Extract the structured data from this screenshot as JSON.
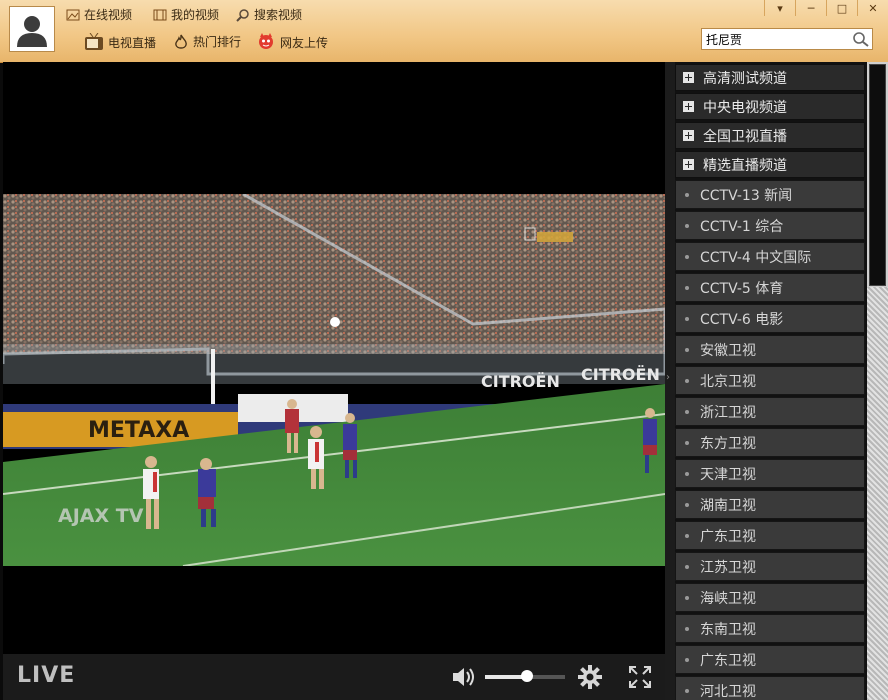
{
  "toolbar": {
    "online_video": "在线视频",
    "my_video": "我的视频",
    "search_video": "搜索视频",
    "tv_live": "电视直播",
    "hot_rank": "热门排行",
    "user_upload": "网友上传",
    "search_value": "托尼贾"
  },
  "player": {
    "live_label": "LIVE",
    "volume_level": 0.52,
    "watermark_channel": "AJAX TV",
    "ad_boards": [
      "METAXA",
      "CITROËN",
      "CITROËN"
    ]
  },
  "categories": [
    "高清测试频道",
    "中央电视频道",
    "全国卫视直播",
    "精选直播频道"
  ],
  "channels": [
    "CCTV-13 新闻",
    "CCTV-1 综合",
    "CCTV-4 中文国际",
    "CCTV-5 体育",
    "CCTV-6 电影",
    "安徽卫视",
    "北京卫视",
    "浙江卫视",
    "东方卫视",
    "天津卫视",
    "湖南卫视",
    "广东卫视",
    "江苏卫视",
    "海峡卫视",
    "东南卫视",
    "广东卫视",
    "河北卫视"
  ],
  "colors": {
    "toolbar": "#f1c684",
    "list_item": "#3a3a3a",
    "category": "#2a2a2a",
    "pitch": "#3f8a33"
  }
}
